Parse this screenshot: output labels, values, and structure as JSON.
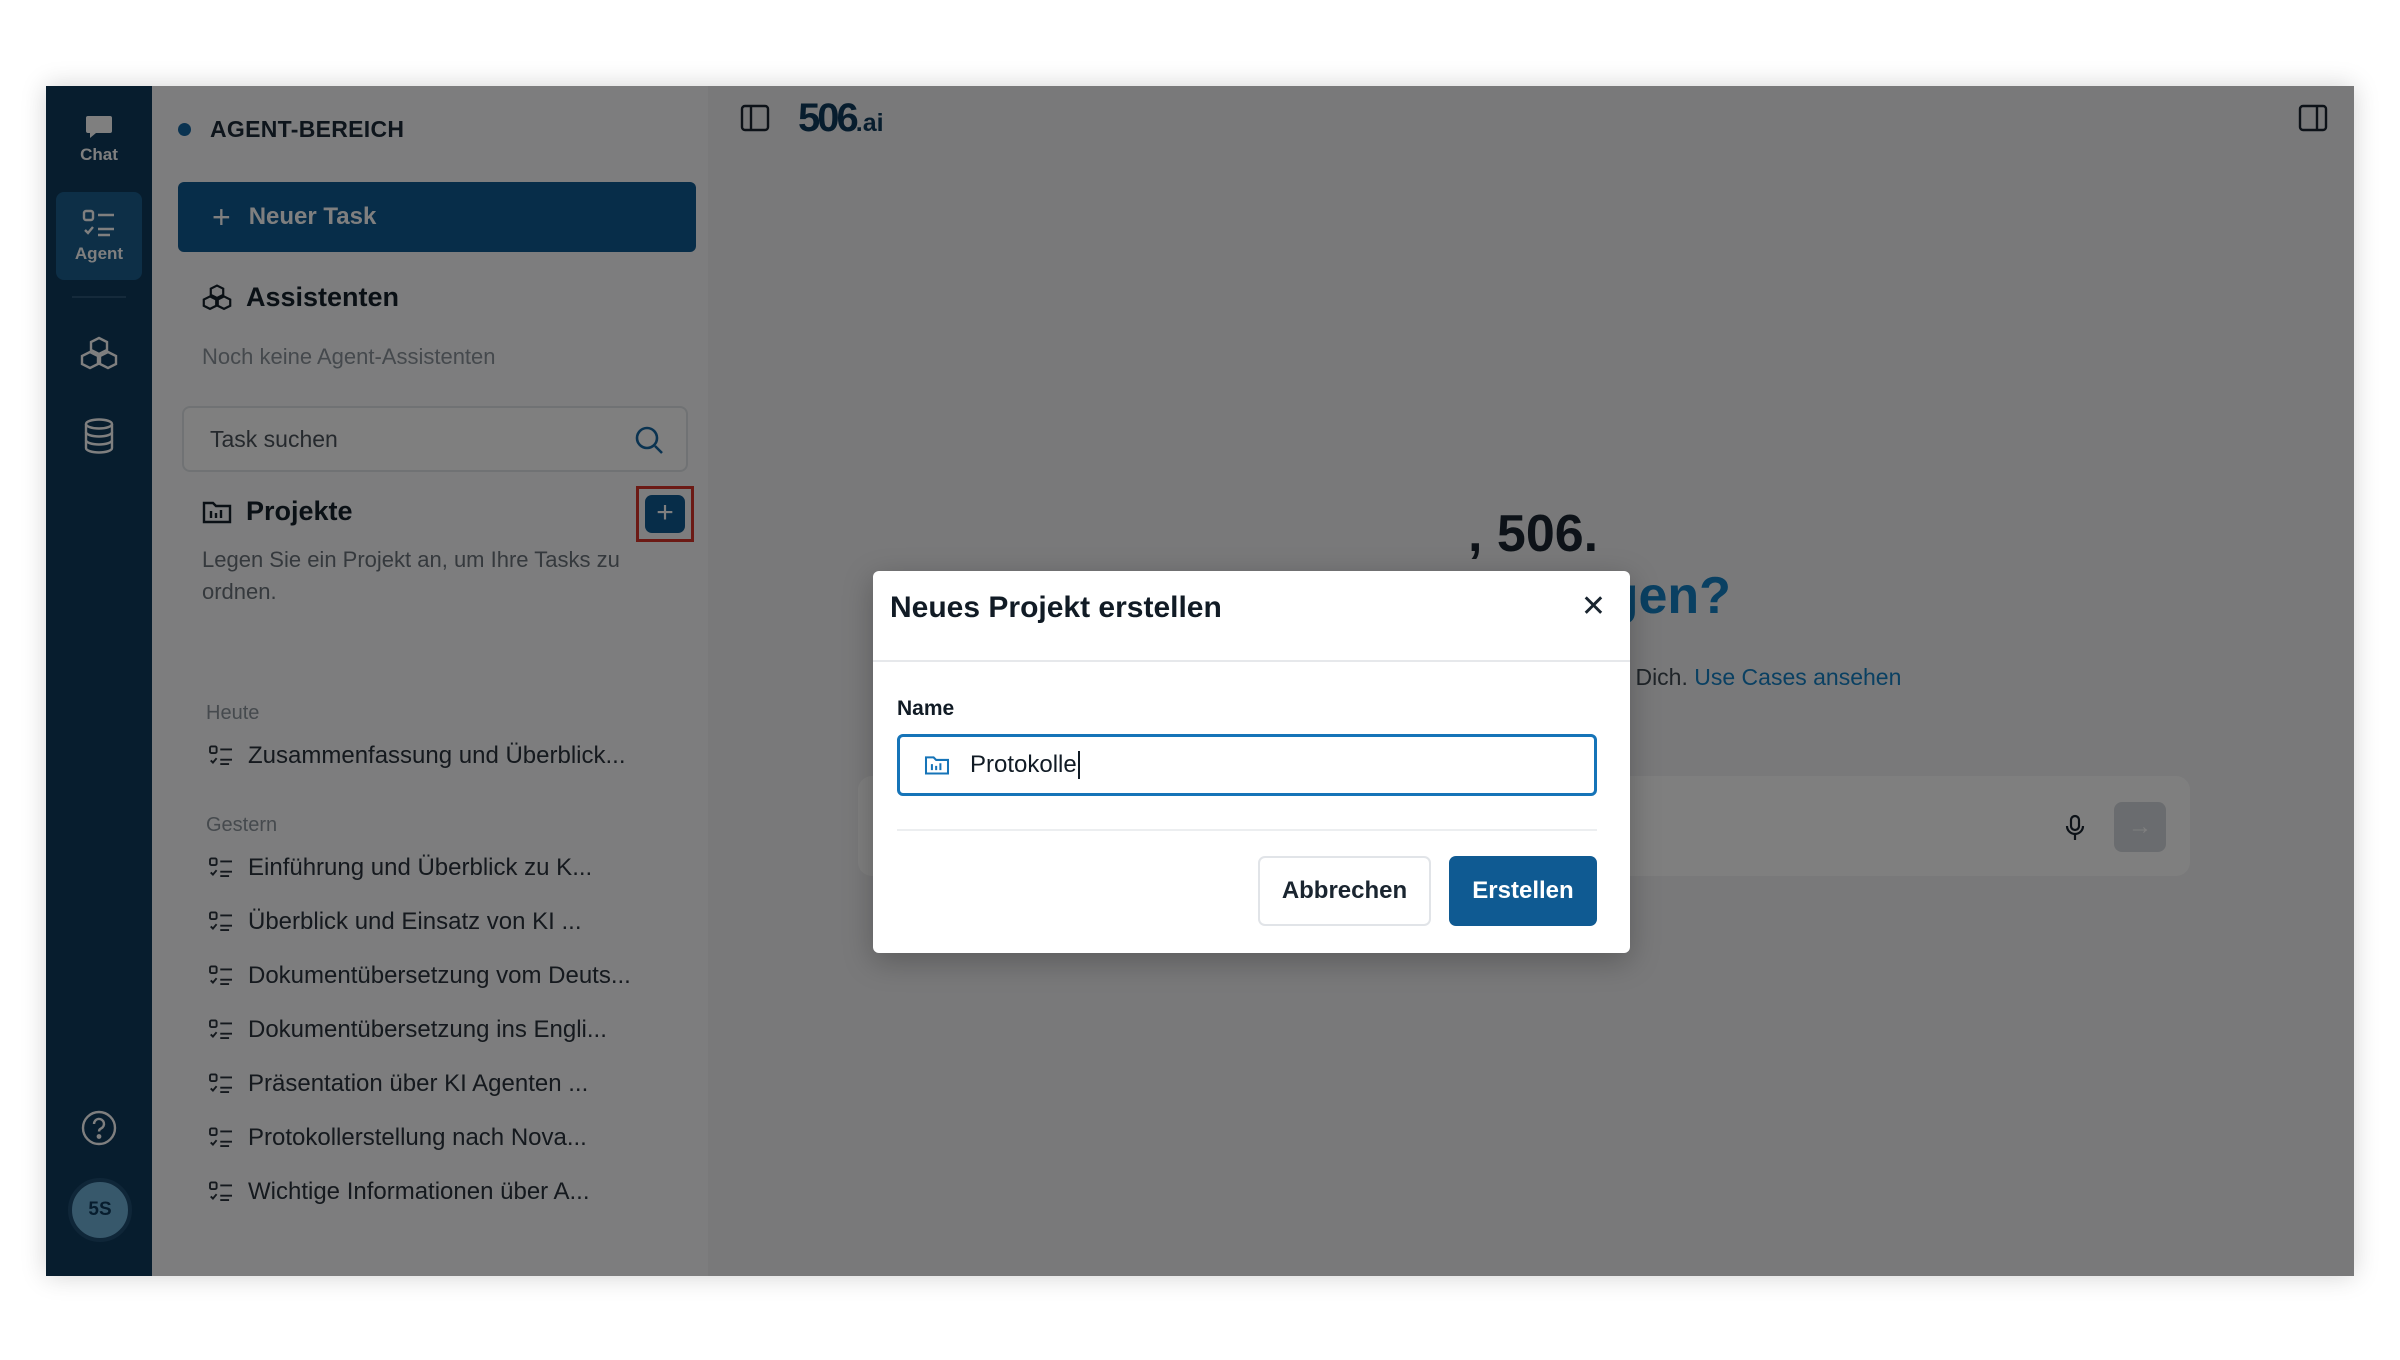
{
  "rail": {
    "chat_label": "Chat",
    "agent_label": "Agent",
    "avatar_initials": "5S"
  },
  "sidebar": {
    "area_label": "AGENT-BEREICH",
    "new_task_label": "Neuer Task",
    "assistants_title": "Assistenten",
    "assistants_empty": "Noch keine Agent-Assistenten",
    "search_placeholder": "Task suchen",
    "projects_title": "Projekte",
    "projects_hint": "Legen Sie ein Projekt an, um Ihre Tasks zu ordnen.",
    "groups": [
      {
        "label": "Heute",
        "tasks": [
          "Zusammenfassung und Überblick..."
        ]
      },
      {
        "label": "Gestern",
        "tasks": [
          "Einführung und Überblick zu K...",
          "Überblick und Einsatz von KI ...",
          "Dokumentübersetzung vom Deuts...",
          "Dokumentübersetzung ins Engli...",
          "Präsentation über KI Agenten ...",
          "Protokollerstellung nach Nova...",
          "Wichtige Informationen über A..."
        ]
      }
    ]
  },
  "main": {
    "logo_main": "506",
    "logo_suffix": ".ai",
    "greeting_line1": ", 506.",
    "greeting_line2": "erledigen?",
    "subtitle": "xcel-Dateien für Dich.",
    "use_cases_link": "Use Cases ansehen"
  },
  "modal": {
    "title": "Neues Projekt erstellen",
    "close_glyph": "✕",
    "name_label": "Name",
    "name_value": "Protokolle",
    "cancel_label": "Abbrechen",
    "create_label": "Erstellen"
  },
  "colors": {
    "rail_bg": "#0f3a5c",
    "primary": "#0f5a92",
    "accent": "#1580c4",
    "highlight_border": "#d9342b"
  }
}
